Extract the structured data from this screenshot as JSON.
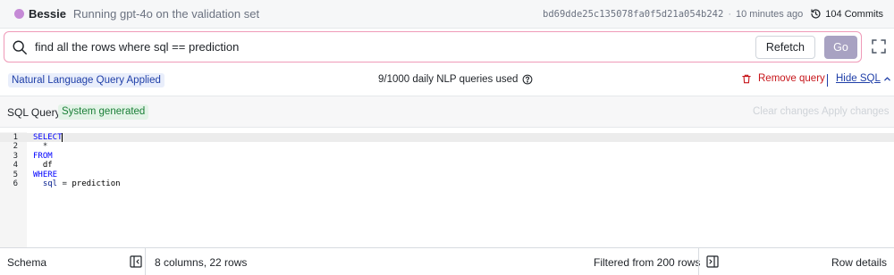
{
  "topbar": {
    "user_name": "Bessie",
    "avatar_color": "#c58ad6",
    "subtitle": "Running gpt-4o on the validation set",
    "commit_hash": "bd69dde25c135078fa0f5d21a054b242",
    "separator": "·",
    "time_ago": "10 minutes ago",
    "commits_label": "104 Commits",
    "commits_icon": "history-icon"
  },
  "query": {
    "value": "find all the rows where sql == prediction",
    "search_icon": "search-icon",
    "refetch_label": "Refetch",
    "go_label": "Go",
    "expand_icon": "expand-icon",
    "border_color": "#ef9ab8",
    "go_color": "#a8a2c2"
  },
  "info": {
    "nlq_badge": "Natural Language Query Applied",
    "usage": "9/1000 daily NLP queries used",
    "usage_icon": "help-circle-icon",
    "remove_query": "Remove query",
    "remove_icon": "trash-icon",
    "hide_sql": "Hide SQL",
    "hide_icon": "chevron-up-icon"
  },
  "sql": {
    "title": "SQL Query",
    "badge": "System generated",
    "clear_changes": "Clear changes",
    "apply_changes": "Apply changes",
    "lines": [
      {
        "num": "1",
        "parts": [
          {
            "t": "SELECT",
            "c": "kw"
          }
        ]
      },
      {
        "num": "2",
        "parts": [
          {
            "t": "  *",
            "c": "op"
          }
        ]
      },
      {
        "num": "3",
        "parts": [
          {
            "t": "FROM",
            "c": "kw"
          }
        ]
      },
      {
        "num": "4",
        "parts": [
          {
            "t": "  df",
            "c": "ident"
          }
        ]
      },
      {
        "num": "5",
        "parts": [
          {
            "t": "WHERE",
            "c": "kw"
          }
        ]
      },
      {
        "num": "6",
        "parts": [
          {
            "t": "  sql",
            "c": "vcol"
          },
          {
            "t": " = ",
            "c": "op"
          },
          {
            "t": "prediction",
            "c": "ident"
          }
        ]
      }
    ]
  },
  "footer": {
    "schema": "Schema",
    "columns_rows": "8 columns, 22 rows",
    "filtered": "Filtered from 200 rows",
    "row_details": "Row details",
    "panel_icon": "panel-toggle-icon"
  }
}
